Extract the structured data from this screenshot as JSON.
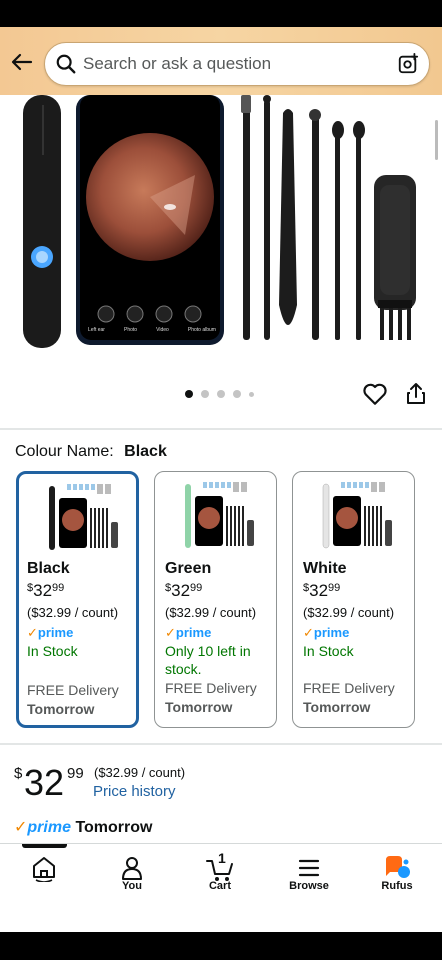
{
  "search": {
    "placeholder": "Search or ask a question"
  },
  "carousel": {
    "total_images": 5,
    "active_index": 0
  },
  "product_image": {
    "phone_labels": [
      "Left ear",
      "Photo",
      "Video",
      "Photo album"
    ]
  },
  "colour": {
    "label": "Colour Name:",
    "selected": "Black"
  },
  "variants": [
    {
      "name": "Black",
      "price_whole": "32",
      "price_frac": "99",
      "currency": "$",
      "unit_price": "($32.99 / count)",
      "prime": "prime",
      "stock": "In Stock",
      "delivery": "FREE Delivery",
      "delivery_day": "Tomorrow",
      "selected": true
    },
    {
      "name": "Green",
      "price_whole": "32",
      "price_frac": "99",
      "currency": "$",
      "unit_price": "($32.99 / count)",
      "prime": "prime",
      "stock": "Only 10 left in stock.",
      "delivery": "FREE Delivery",
      "delivery_day": "Tomorrow",
      "selected": false
    },
    {
      "name": "White",
      "price_whole": "32",
      "price_frac": "99",
      "currency": "$",
      "unit_price": "($32.99 / count)",
      "prime": "prime",
      "stock": "In Stock",
      "delivery": "FREE Delivery",
      "delivery_day": "Tomorrow",
      "selected": false
    }
  ],
  "price": {
    "currency": "$",
    "whole": "32",
    "fraction": "99",
    "unit_price": "($32.99 / count)",
    "history_link": "Price history"
  },
  "delivery": {
    "check": "✓",
    "prime": "prime",
    "day": "Tomorrow"
  },
  "nav": {
    "items": [
      {
        "label": "",
        "icon": "home-icon"
      },
      {
        "label": "You",
        "icon": "user-icon"
      },
      {
        "label": "Cart",
        "icon": "cart-icon",
        "badge": "1"
      },
      {
        "label": "Browse",
        "icon": "menu-icon"
      },
      {
        "label": "Rufus",
        "icon": "rufus-icon"
      }
    ]
  },
  "colors": {
    "header_bg": "#f3c893",
    "link_blue": "#2162a1",
    "in_stock_green": "#007600",
    "prime_blue": "#1a98ff",
    "prime_check_orange": "#f08804",
    "selected_border": "#2162a1",
    "rufus_orange": "#ff6a13",
    "rufus_blue": "#1a98ff"
  }
}
